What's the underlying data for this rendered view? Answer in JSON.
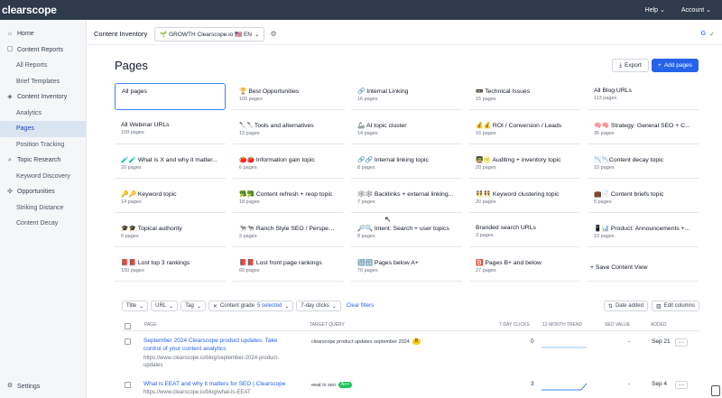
{
  "topbar": {
    "logo": "clearscope",
    "help": "Help",
    "account": "Account"
  },
  "sidebar": {
    "home": "Home",
    "content_reports": "Content Reports",
    "all_reports": "All Reports",
    "brief_templates": "Brief Templates",
    "content_inventory": "Content Inventory",
    "analytics": "Analytics",
    "pages": "Pages",
    "position_tracking": "Position Tracking",
    "topic_research": "Topic Research",
    "keyword_discovery": "Keyword Discovery",
    "opportunities": "Opportunities",
    "striking_distance": "Striking Distance",
    "content_decay": "Content Decay",
    "settings": "Settings"
  },
  "header": {
    "title": "Content Inventory",
    "workspace": "🌱 GROWTH Clearscope.io 🇺🇸 EN"
  },
  "page": {
    "title": "Pages",
    "export": "Export",
    "add": "Add pages"
  },
  "cards": [
    {
      "name": "All pages",
      "count": ""
    },
    {
      "name": "🏆 Best Opportunities",
      "count": "105 pages"
    },
    {
      "name": "🔗 Internal Linking",
      "count": "16 pages"
    },
    {
      "name": "🚥 Technical Issues",
      "count": "15 pages"
    },
    {
      "name": "All Blog URLs",
      "count": "113 pages"
    },
    {
      "name": "All Webinar URLs",
      "count": "109 pages"
    },
    {
      "name": "🔪🔪Tools and alternatives",
      "count": "13 pages"
    },
    {
      "name": "🦾 AI topic cluster",
      "count": "14 pages"
    },
    {
      "name": "💰💰 ROI / Conversion / Leads",
      "count": "16 pages"
    },
    {
      "name": "🧠🧠 Strategy: General SEO + C...",
      "count": "35 pages"
    },
    {
      "name": "🧪🧪 What is X and why it matter...",
      "count": "20 pages"
    },
    {
      "name": "🍅🍅 Information gain topic",
      "count": "6 pages"
    },
    {
      "name": "🔗🔗 Internal linking topic",
      "count": "8 pages"
    },
    {
      "name": "🧑‍🏫🌝 Auditing + inventory topic",
      "count": "20 pages"
    },
    {
      "name": "📉📉Content decay topic",
      "count": "10 pages"
    },
    {
      "name": "🔑🔑 Keyword topic",
      "count": "14 pages"
    },
    {
      "name": "🥦🥦 Content refresh + reop topic",
      "count": "18 pages"
    },
    {
      "name": "🕸️🕸️ Backlinks + external linking...",
      "count": "7 pages"
    },
    {
      "name": "👯👯 Keyword clustering topic",
      "count": "20 pages"
    },
    {
      "name": "💼📄 Content briefs topic",
      "count": "5 pages"
    },
    {
      "name": "🎓🎓 Topical authority",
      "count": "6 pages"
    },
    {
      "name": "🐄🐄 Ranch Style SEO / Perspect...",
      "count": "2 pages"
    },
    {
      "name": "🔎🔍 Intent: Search + user topics",
      "count": "8 pages"
    },
    {
      "name": "Branded search URLs",
      "count": "3 pages"
    },
    {
      "name": "📱📊 Product: Announcements +...",
      "count": "10 pages"
    },
    {
      "name": "📕📕 Lost top 3 rankings",
      "count": "100 pages"
    },
    {
      "name": "📕📕 Lost front page rankings",
      "count": "66 pages"
    },
    {
      "name": "🔢🔢 Pages below A+",
      "count": "70 pages"
    },
    {
      "name": "🅱️ Pages B+ and below",
      "count": "27 pages"
    }
  ],
  "save_view": "+ Save Content View",
  "filters": {
    "title": "Title",
    "url": "URL",
    "tag": "Tag",
    "grade_label": "Content grade",
    "grade_value": "5 selected",
    "clicks": "7-day clicks",
    "clear": "Clear filters",
    "date_added": "Date added",
    "edit_columns": "Edit columns"
  },
  "table": {
    "headers": {
      "page": "PAGE",
      "query": "TARGET QUERY",
      "clicks": "7-DAY CLICKS",
      "trend": "12-MONTH TREND",
      "seo": "SEO VALUE",
      "added": "ADDED"
    },
    "rows": [
      {
        "title1": "September 2024 Clearscope product updates: Take",
        "title2": "control of your content analytics",
        "url1": "https://www.clearscope.io/blog/september-2024-product-",
        "url2": "updates",
        "query": "clearscope product updates september 2024",
        "grade": "B",
        "grade_color": "#facc15",
        "clicks": "0",
        "seo": "-",
        "added": "Sep 21"
      },
      {
        "title1": "What is EEAT and why it matters for SEO | Clearscope",
        "url1": "https://www.clearscope.io/blog/what-is-EEAT",
        "query": "eeat in seo",
        "grade": "A++",
        "grade_color": "#22c55e",
        "clicks": "3",
        "seo": "-",
        "added": "Sep 4"
      }
    ]
  }
}
